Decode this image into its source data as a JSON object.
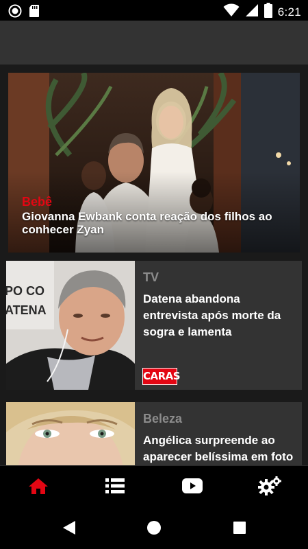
{
  "status_bar": {
    "time": "6:21",
    "icons": [
      "record-icon",
      "sd-card-icon",
      "wifi-icon",
      "signal-icon",
      "battery-icon"
    ]
  },
  "hero": {
    "category": "Bebê",
    "title": "Giovanna Ewbank conta reação dos filhos ao conhecer Zyan"
  },
  "cards": [
    {
      "category": "TV",
      "title": "Datena abandona entrevista após morte da sogra e lamenta",
      "logo_text": "CARAS",
      "photo_backdrop_text": "PO CO\nATENA"
    },
    {
      "category": "Beleza",
      "title": "Angélica surpreende ao aparecer belíssima em foto"
    }
  ],
  "bottom_nav": {
    "items": [
      "home-icon",
      "list-icon",
      "youtube-icon",
      "settings-icon"
    ],
    "active_color": "#e30613",
    "inactive_color": "#ffffff"
  },
  "colors": {
    "accent": "#e30613",
    "card_bg": "#333333",
    "feed_bg": "#1a1a1a",
    "category_gray": "#8c8c8c"
  }
}
